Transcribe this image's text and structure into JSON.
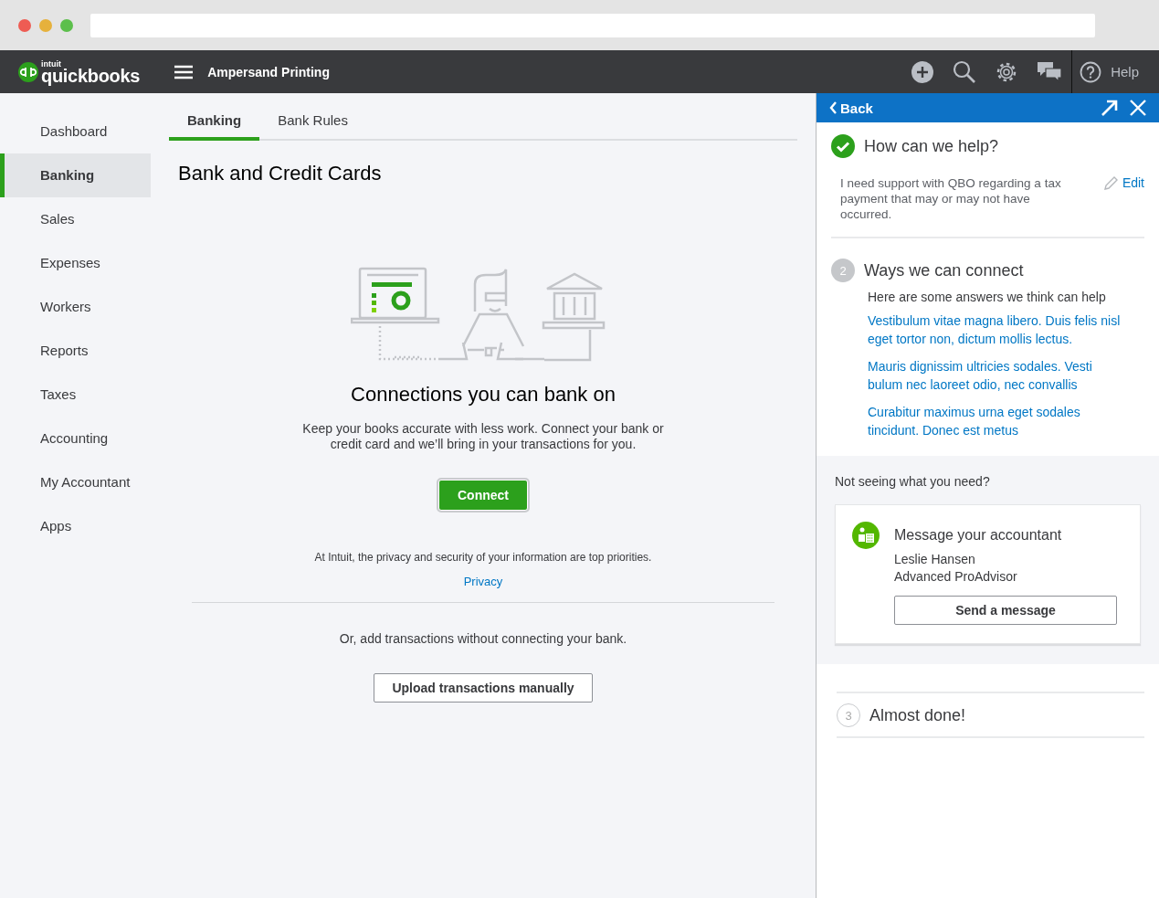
{
  "browser": {
    "traffic_lights": [
      {
        "color": "#ee5c53"
      },
      {
        "color": "#e6b13c"
      },
      {
        "color": "#5cbf4b"
      }
    ]
  },
  "header": {
    "logo_small": "intuit",
    "logo": "quickbooks",
    "company": "Ampersand Printing",
    "help": "Help"
  },
  "sidebar": {
    "items": [
      {
        "label": "Dashboard",
        "selected": false
      },
      {
        "label": "Banking",
        "selected": true
      },
      {
        "label": "Sales",
        "selected": false
      },
      {
        "label": "Expenses",
        "selected": false
      },
      {
        "label": "Workers",
        "selected": false
      },
      {
        "label": "Reports",
        "selected": false
      },
      {
        "label": "Taxes",
        "selected": false
      },
      {
        "label": "Accounting",
        "selected": false
      },
      {
        "label": "My Accountant",
        "selected": false
      },
      {
        "label": "Apps",
        "selected": false
      }
    ]
  },
  "tabs": [
    {
      "label": "Banking",
      "selected": true
    },
    {
      "label": "Bank Rules",
      "selected": false
    }
  ],
  "main": {
    "title": "Bank and Credit Cards",
    "headline": "Connections you can bank on",
    "description": "Keep your books accurate with less work. Connect your bank or credit card and we’ll bring in your transactions for you.",
    "connect_button": "Connect",
    "privacy_note": "At Intuit, the privacy and security of your information are top priorities.",
    "privacy_link": "Privacy",
    "alternative": "Or, add transactions without connecting your bank.",
    "upload_button": "Upload transactions manually"
  },
  "help_panel": {
    "back": "Back",
    "steps": [
      {
        "kind": "done",
        "title": "How can we help?",
        "description": "I need support with QBO regarding a tax payment that may or may not have occurred.",
        "edit": "Edit"
      },
      {
        "kind": "active",
        "number": "2",
        "title": "Ways we can connect",
        "intro": "Here are some answers we think can help",
        "links": [
          "Vestibulum vitae magna libero. Duis felis nisl eget tortor non, dictum mollis lectus.",
          "Mauris dignissim ultricies sodales. Vesti bulum nec laoreet odio, nec convallis",
          "Curabitur maximus urna eget sodales tincidunt. Donec est metus"
        ]
      }
    ],
    "not_seeing": "Not seeing what you need?",
    "card": {
      "title": "Message your accountant",
      "name": "Leslie Hansen",
      "role": "Advanced ProAdvisor",
      "button": "Send a message"
    },
    "pending_steps": [
      {
        "kind": "pending",
        "number": "3",
        "title": "Almost done!"
      }
    ]
  }
}
